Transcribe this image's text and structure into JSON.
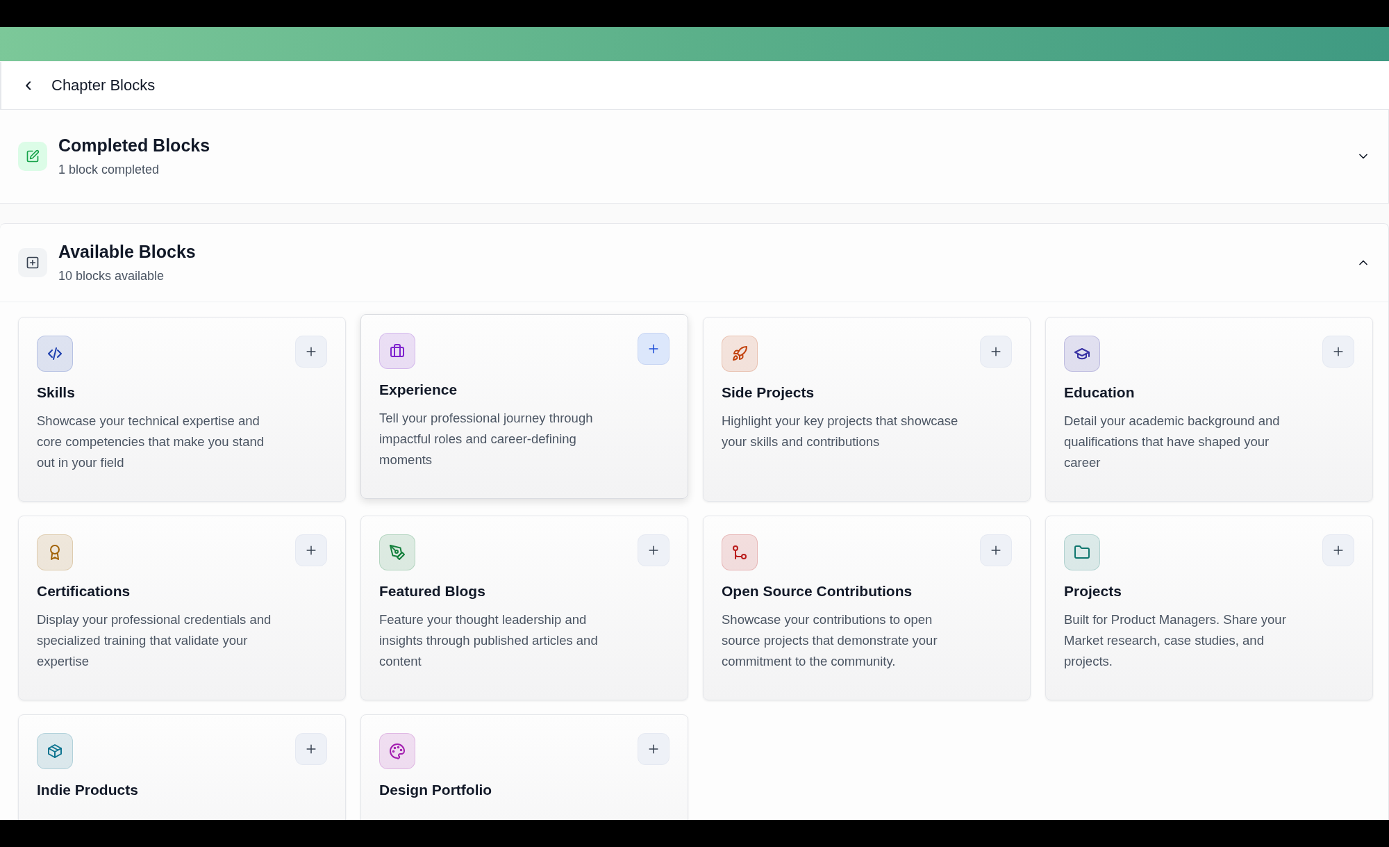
{
  "header": {
    "back_icon": "‹",
    "title": "Chapter Blocks"
  },
  "sections": [
    {
      "kind": "completed",
      "title": "Completed Blocks",
      "subtitle": "1 block completed",
      "expanded": false
    },
    {
      "kind": "available",
      "title": "Available Blocks",
      "subtitle": "10 blocks available",
      "expanded": true,
      "blocks": [
        {
          "kind": "code",
          "color": "#1e40af",
          "title": "Skills",
          "description": "Showcase your technical expertise and core competencies that make you stand out in your field",
          "highlighted": false
        },
        {
          "kind": "briefcase",
          "color": "#7e22ce",
          "title": "Experience",
          "description": "Tell your professional journey through impactful roles and career-defining moments",
          "highlighted": true
        },
        {
          "kind": "rocket",
          "color": "#c2410c",
          "title": "Side Projects",
          "description": "Highlight your key projects that showcase your skills and contributions",
          "highlighted": false
        },
        {
          "kind": "cap",
          "color": "#3730a3",
          "title": "Education",
          "description": "Detail your academic background and qualifications that have shaped your career",
          "highlighted": false
        },
        {
          "kind": "award",
          "color": "#a16207",
          "title": "Certifications",
          "description": "Display your professional credentials and specialized training that validate your expertise",
          "highlighted": false
        },
        {
          "kind": "pen",
          "color": "#15803d",
          "title": "Featured Blogs",
          "description": "Feature your thought leadership and insights through published articles and content",
          "highlighted": false
        },
        {
          "kind": "git",
          "color": "#b91c1c",
          "title": "Open Source Contributions",
          "description": "Showcase your contributions to open source projects that demonstrate your commitment to the community.",
          "highlighted": false
        },
        {
          "kind": "folder",
          "color": "#0f766e",
          "title": "Projects",
          "description": "Built for Product Managers. Share your Market research, case studies, and projects.",
          "highlighted": false
        },
        {
          "kind": "box",
          "color": "#0e7490",
          "title": "Indie Products",
          "highlighted": false
        },
        {
          "kind": "palette",
          "color": "#a21caf",
          "title": "Design Portfolio",
          "highlighted": false
        }
      ]
    }
  ]
}
